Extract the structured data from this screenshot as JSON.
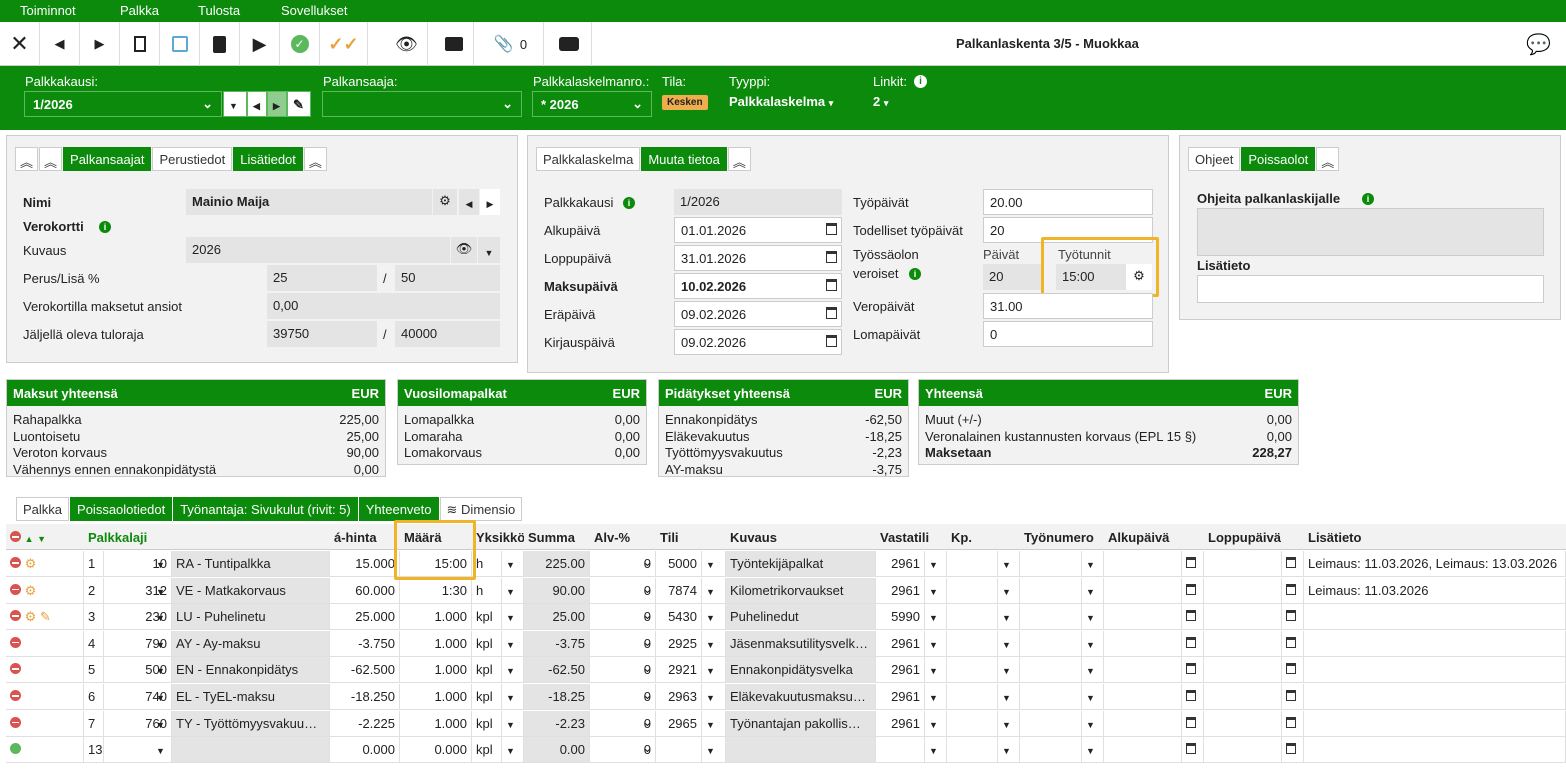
{
  "menu": [
    "Toiminnot",
    "Palkka",
    "Tulosta",
    "Sovellukset"
  ],
  "toolbar": {
    "title": "Palkanlaskenta 3/5 - Muokkaa",
    "attach_count": "0"
  },
  "header": {
    "period_label": "Palkkakausi:",
    "period_value": "1/2026",
    "earner_label": "Palkansaaja:",
    "earner_value": "",
    "calcnum_label": "Palkkalaskelmanro.:",
    "calcnum_value": "* 2026",
    "status_label": "Tila:",
    "status_value": "Kesken",
    "type_label": "Tyyppi:",
    "type_value": "Palkkalaskelma",
    "links_label": "Linkit:",
    "links_value": "2"
  },
  "left_panel": {
    "tabs": [
      "Palkansaajat",
      "Perustiedot",
      "Lisätiedot"
    ],
    "name_label": "Nimi",
    "name_value": "Mainio Maija",
    "taxcard_label": "Verokortti",
    "desc_label": "Kuvaus",
    "desc_value": "2026",
    "rate_label": "Perus/Lisä %",
    "rate_base": "25",
    "rate_sep": "/",
    "rate_extra": "50",
    "paid_label": "Verokortilla maksetut ansiot",
    "paid_value": "0,00",
    "limit_label": "Jäljellä oleva tuloraja",
    "limit_value": "39750",
    "limit_sep": "/",
    "limit_total": "40000"
  },
  "mid_panel": {
    "tabs": [
      "Palkkalaskelma",
      "Muuta tietoa"
    ],
    "period_label": "Palkkakausi",
    "period_value": "1/2026",
    "start_label": "Alkupäivä",
    "start_value": "01.01.2026",
    "end_label": "Loppupäivä",
    "end_value": "31.01.2026",
    "pay_label": "Maksupäivä",
    "pay_value": "10.02.2026",
    "due_label": "Eräpäivä",
    "due_value": "09.02.2026",
    "book_label": "Kirjauspäivä",
    "book_value": "09.02.2026",
    "workdays_label": "Työpäivät",
    "workdays_value": "20.00",
    "actual_label": "Todelliset työpäivät",
    "actual_value": "20",
    "employment_label1": "Työssäolon",
    "employment_label2": "veroiset",
    "days_label": "Päivät",
    "days_value": "20",
    "hours_label": "Työtunnit",
    "hours_value": "15:00",
    "taxdays_label": "Veropäivät",
    "taxdays_value": "31.00",
    "holiday_label": "Lomapäivät",
    "holiday_value": "0"
  },
  "right_panel": {
    "tabs": [
      "Ohjeet",
      "Poissaolot"
    ],
    "instr_label": "Ohjeita palkanlaskijalle",
    "extra_label": "Lisätieto"
  },
  "summaries": [
    {
      "title": "Maksut yhteensä",
      "cur": "EUR",
      "rows": [
        [
          "Rahapalkka",
          "225,00"
        ],
        [
          "Luontoisetu",
          "25,00"
        ],
        [
          "Veroton korvaus",
          "90,00"
        ],
        [
          "Vähennys ennen ennakonpidätystä",
          "0,00"
        ]
      ]
    },
    {
      "title": "Vuosilomapalkat",
      "cur": "EUR",
      "rows": [
        [
          "Lomapalkka",
          "0,00"
        ],
        [
          "Lomaraha",
          "0,00"
        ],
        [
          "Lomakorvaus",
          "0,00"
        ]
      ]
    },
    {
      "title": "Pidätykset yhteensä",
      "cur": "EUR",
      "rows": [
        [
          "Ennakonpidätys",
          "-62,50"
        ],
        [
          "Eläkevakuutus",
          "-18,25"
        ],
        [
          "Työttömyysvakuutus",
          "-2,23"
        ],
        [
          "AY-maksu",
          "-3,75"
        ]
      ]
    },
    {
      "title": "Yhteensä",
      "cur": "EUR",
      "rows": [
        [
          "Muut (+/-)",
          "0,00"
        ],
        [
          "Veronalainen kustannusten korvaus (EPL 15 §)",
          "0,00"
        ],
        [
          "Maksetaan",
          "228,27"
        ]
      ]
    }
  ],
  "bottom_tabs": [
    "Palkka",
    "Poissaolotiedot",
    "Työnantaja: Sivukulut (rivit: 5)",
    "Yhteenveto",
    "Dimensio"
  ],
  "columns": [
    "Palkkalaji",
    "á-hinta",
    "Määrä",
    "Yksikkö",
    "Summa",
    "Alv-%",
    "Tili",
    "Kuvaus",
    "Vastatili",
    "Kp.",
    "Työnumero",
    "Alkupäivä",
    "Loppupäivä",
    "Lisätieto"
  ],
  "rows": [
    {
      "n": "1",
      "code": "10",
      "name": "RA - Tuntipalkka",
      "price": "15.000",
      "qty": "15:00",
      "unit": "h",
      "sum": "225.00",
      "vat": "0",
      "acc": "5000",
      "desc": "Työntekijäpalkat",
      "contra": "2961",
      "info": "Leimaus: 11.03.2026, Leimaus: 13.03.2026"
    },
    {
      "n": "2",
      "code": "312",
      "name": "VE - Matkakorvaus",
      "price": "60.000",
      "qty": "1:30",
      "unit": "h",
      "sum": "90.00",
      "vat": "0",
      "acc": "7874",
      "desc": "Kilometrikorvaukset",
      "contra": "2961",
      "info": "Leimaus: 11.03.2026"
    },
    {
      "n": "3",
      "code": "230",
      "name": "LU - Puhelinetu",
      "price": "25.000",
      "qty": "1.000",
      "unit": "kpl",
      "sum": "25.00",
      "vat": "0",
      "acc": "5430",
      "desc": "Puhelinedut",
      "contra": "5990",
      "info": ""
    },
    {
      "n": "4",
      "code": "790",
      "name": "AY - Ay-maksu",
      "price": "-3.750",
      "qty": "1.000",
      "unit": "kpl",
      "sum": "-3.75",
      "vat": "0",
      "acc": "2925",
      "desc": "Jäsenmaksutilitysvelk…",
      "contra": "2961",
      "info": ""
    },
    {
      "n": "5",
      "code": "500",
      "name": "EN - Ennakonpidätys",
      "price": "-62.500",
      "qty": "1.000",
      "unit": "kpl",
      "sum": "-62.50",
      "vat": "0",
      "acc": "2921",
      "desc": "Ennakonpidätysvelka",
      "contra": "2961",
      "info": ""
    },
    {
      "n": "6",
      "code": "740",
      "name": "EL - TyEL-maksu",
      "price": "-18.250",
      "qty": "1.000",
      "unit": "kpl",
      "sum": "-18.25",
      "vat": "0",
      "acc": "2963",
      "desc": "Eläkevakuutusmaksu…",
      "contra": "2961",
      "info": ""
    },
    {
      "n": "7",
      "code": "760",
      "name": "TY - Työttömyysvakuu…",
      "price": "-2.225",
      "qty": "1.000",
      "unit": "kpl",
      "sum": "-2.23",
      "vat": "0",
      "acc": "2965",
      "desc": "Työnantajan pakollis…",
      "contra": "2961",
      "info": ""
    },
    {
      "n": "13",
      "code": "",
      "name": "",
      "price": "0.000",
      "qty": "0.000",
      "unit": "kpl",
      "sum": "0.00",
      "vat": "0",
      "acc": "",
      "desc": "",
      "contra": "",
      "info": ""
    }
  ]
}
